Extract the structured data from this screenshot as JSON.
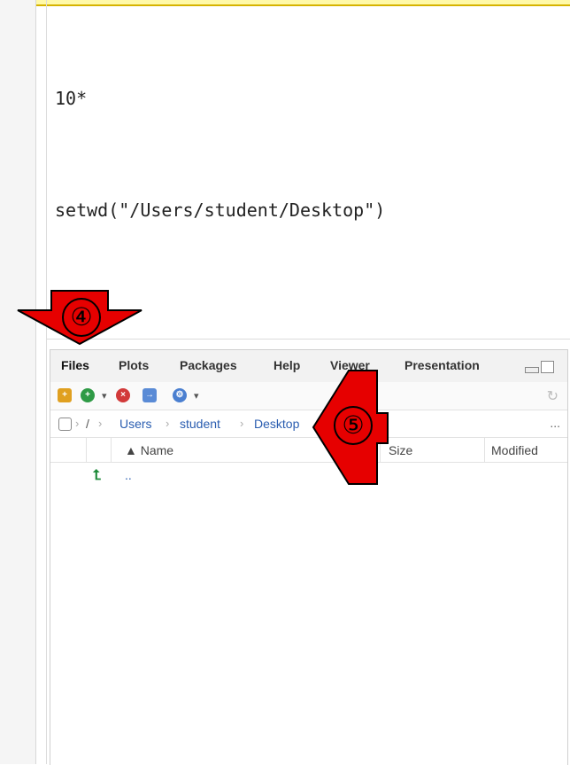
{
  "console": {
    "lines": [
      "10*",
      "setwd(\"/Users/student/Desktop\")"
    ]
  },
  "files_pane": {
    "tabs": [
      "Files",
      "Plots",
      "Packages",
      "Help",
      "Viewer",
      "Presentation"
    ],
    "active_tab": "Files",
    "toolbar": {
      "icons": [
        "new-folder-icon",
        "new-file-icon",
        "delete-icon",
        "rename-icon",
        "gear-icon",
        "refresh-icon"
      ]
    },
    "breadcrumb": [
      "/",
      "Users",
      "student",
      "Desktop"
    ],
    "breadcrumb_more": "...",
    "columns": {
      "name": "▲ Name",
      "size": "Size",
      "modified": "Modified"
    },
    "rows": [
      {
        "name": "..",
        "icon": "up-arrow-icon"
      }
    ]
  },
  "annotations": {
    "step4": "④",
    "step5": "⑤",
    "arrow_color": "#e60000"
  }
}
